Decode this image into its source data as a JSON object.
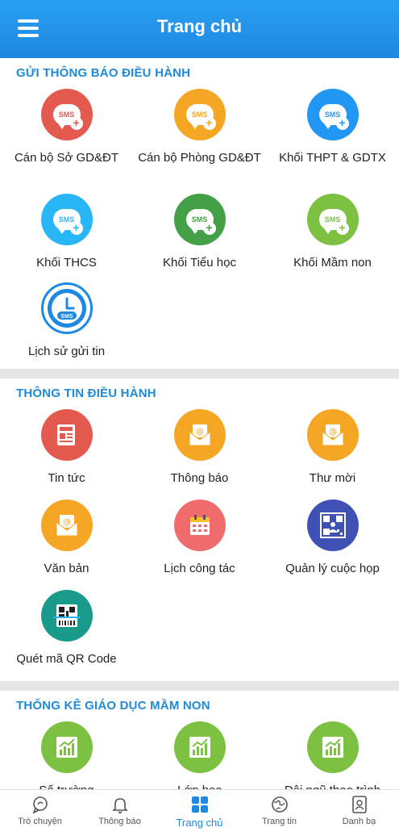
{
  "header": {
    "title": "Trang chủ"
  },
  "sections": [
    {
      "title": "GỬI THÔNG BÁO ĐIỀU HÀNH",
      "items": [
        {
          "label": "Cán bộ Sở GD&ĐT",
          "icon": "sms-add-icon",
          "color": "#e55a4e"
        },
        {
          "label": "Cán bộ Phòng GD&ĐT",
          "icon": "sms-add-icon",
          "color": "#f5a623"
        },
        {
          "label": "Khối THPT & GDTX",
          "icon": "sms-add-icon",
          "color": "#2196f3"
        },
        {
          "label": "Khối THCS",
          "icon": "sms-add-icon",
          "color": "#29b6f6"
        },
        {
          "label": "Khối Tiểu học",
          "icon": "sms-add-icon",
          "color": "#43a047"
        },
        {
          "label": "Khối Mầm non",
          "icon": "sms-add-icon",
          "color": "#7cc142"
        },
        {
          "label": "Lịch sử gửi tin",
          "icon": "sms-history-icon",
          "color": "#1e88e5"
        }
      ],
      "sms_text": "SMS"
    },
    {
      "title": "THÔNG TIN ĐIỀU HÀNH",
      "items": [
        {
          "label": "Tin tức",
          "icon": "newspaper-icon",
          "color": "#e55a4e"
        },
        {
          "label": "Thông báo",
          "icon": "mail-icon",
          "color": "#f5a623"
        },
        {
          "label": "Thư mời",
          "icon": "mail-icon",
          "color": "#f5a623"
        },
        {
          "label": "Văn bản",
          "icon": "mail-icon",
          "color": "#f5a623"
        },
        {
          "label": "Lịch công tác",
          "icon": "calendar-icon",
          "color": "#f06b6b"
        },
        {
          "label": "Quản lý cuộc họp",
          "icon": "meeting-qr-icon",
          "color": "#3f51b5"
        },
        {
          "label": "Quét mã QR Code",
          "icon": "qr-scan-icon",
          "color": "#1a9a8a"
        }
      ]
    },
    {
      "title": "THỐNG KÊ GIÁO DỤC MẦM NON",
      "items": [
        {
          "label": "Số trường",
          "icon": "chart-icon",
          "color": "#7cc142"
        },
        {
          "label": "Lớp học",
          "icon": "chart-icon",
          "color": "#7cc142"
        },
        {
          "label": "Đội ngũ theo trình",
          "icon": "chart-icon",
          "color": "#7cc142"
        }
      ]
    }
  ],
  "bottom_nav": [
    {
      "label": "Trò chuyện",
      "icon": "chat-icon"
    },
    {
      "label": "Thông báo",
      "icon": "bell-icon"
    },
    {
      "label": "Trang chủ",
      "icon": "home-grid-icon",
      "active": true
    },
    {
      "label": "Trang tin",
      "icon": "globe-icon"
    },
    {
      "label": "Danh bạ",
      "icon": "contacts-icon"
    }
  ],
  "colors": {
    "primary": "#1e88e5",
    "section_title": "#1f8ad8",
    "background": "#e6e6e6"
  }
}
